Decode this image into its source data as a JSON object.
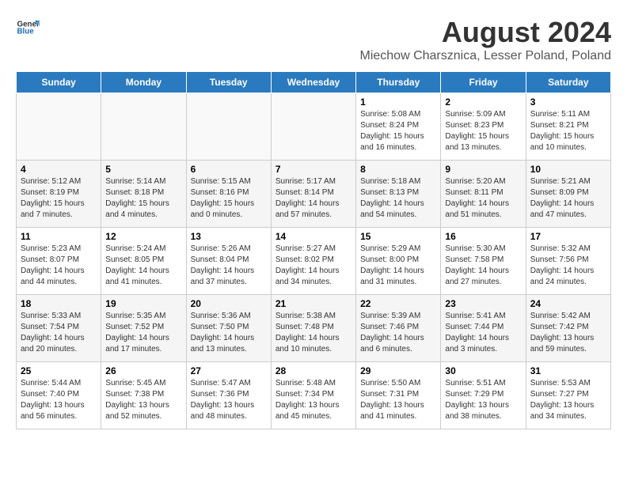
{
  "header": {
    "logo_general": "General",
    "logo_blue": "Blue",
    "title": "August 2024",
    "subtitle": "Miechow Charsznica, Lesser Poland, Poland"
  },
  "days_of_week": [
    "Sunday",
    "Monday",
    "Tuesday",
    "Wednesday",
    "Thursday",
    "Friday",
    "Saturday"
  ],
  "weeks": [
    [
      {
        "day": "",
        "info": ""
      },
      {
        "day": "",
        "info": ""
      },
      {
        "day": "",
        "info": ""
      },
      {
        "day": "",
        "info": ""
      },
      {
        "day": "1",
        "info": "Sunrise: 5:08 AM\nSunset: 8:24 PM\nDaylight: 15 hours\nand 16 minutes."
      },
      {
        "day": "2",
        "info": "Sunrise: 5:09 AM\nSunset: 8:23 PM\nDaylight: 15 hours\nand 13 minutes."
      },
      {
        "day": "3",
        "info": "Sunrise: 5:11 AM\nSunset: 8:21 PM\nDaylight: 15 hours\nand 10 minutes."
      }
    ],
    [
      {
        "day": "4",
        "info": "Sunrise: 5:12 AM\nSunset: 8:19 PM\nDaylight: 15 hours\nand 7 minutes."
      },
      {
        "day": "5",
        "info": "Sunrise: 5:14 AM\nSunset: 8:18 PM\nDaylight: 15 hours\nand 4 minutes."
      },
      {
        "day": "6",
        "info": "Sunrise: 5:15 AM\nSunset: 8:16 PM\nDaylight: 15 hours\nand 0 minutes."
      },
      {
        "day": "7",
        "info": "Sunrise: 5:17 AM\nSunset: 8:14 PM\nDaylight: 14 hours\nand 57 minutes."
      },
      {
        "day": "8",
        "info": "Sunrise: 5:18 AM\nSunset: 8:13 PM\nDaylight: 14 hours\nand 54 minutes."
      },
      {
        "day": "9",
        "info": "Sunrise: 5:20 AM\nSunset: 8:11 PM\nDaylight: 14 hours\nand 51 minutes."
      },
      {
        "day": "10",
        "info": "Sunrise: 5:21 AM\nSunset: 8:09 PM\nDaylight: 14 hours\nand 47 minutes."
      }
    ],
    [
      {
        "day": "11",
        "info": "Sunrise: 5:23 AM\nSunset: 8:07 PM\nDaylight: 14 hours\nand 44 minutes."
      },
      {
        "day": "12",
        "info": "Sunrise: 5:24 AM\nSunset: 8:05 PM\nDaylight: 14 hours\nand 41 minutes."
      },
      {
        "day": "13",
        "info": "Sunrise: 5:26 AM\nSunset: 8:04 PM\nDaylight: 14 hours\nand 37 minutes."
      },
      {
        "day": "14",
        "info": "Sunrise: 5:27 AM\nSunset: 8:02 PM\nDaylight: 14 hours\nand 34 minutes."
      },
      {
        "day": "15",
        "info": "Sunrise: 5:29 AM\nSunset: 8:00 PM\nDaylight: 14 hours\nand 31 minutes."
      },
      {
        "day": "16",
        "info": "Sunrise: 5:30 AM\nSunset: 7:58 PM\nDaylight: 14 hours\nand 27 minutes."
      },
      {
        "day": "17",
        "info": "Sunrise: 5:32 AM\nSunset: 7:56 PM\nDaylight: 14 hours\nand 24 minutes."
      }
    ],
    [
      {
        "day": "18",
        "info": "Sunrise: 5:33 AM\nSunset: 7:54 PM\nDaylight: 14 hours\nand 20 minutes."
      },
      {
        "day": "19",
        "info": "Sunrise: 5:35 AM\nSunset: 7:52 PM\nDaylight: 14 hours\nand 17 minutes."
      },
      {
        "day": "20",
        "info": "Sunrise: 5:36 AM\nSunset: 7:50 PM\nDaylight: 14 hours\nand 13 minutes."
      },
      {
        "day": "21",
        "info": "Sunrise: 5:38 AM\nSunset: 7:48 PM\nDaylight: 14 hours\nand 10 minutes."
      },
      {
        "day": "22",
        "info": "Sunrise: 5:39 AM\nSunset: 7:46 PM\nDaylight: 14 hours\nand 6 minutes."
      },
      {
        "day": "23",
        "info": "Sunrise: 5:41 AM\nSunset: 7:44 PM\nDaylight: 14 hours\nand 3 minutes."
      },
      {
        "day": "24",
        "info": "Sunrise: 5:42 AM\nSunset: 7:42 PM\nDaylight: 13 hours\nand 59 minutes."
      }
    ],
    [
      {
        "day": "25",
        "info": "Sunrise: 5:44 AM\nSunset: 7:40 PM\nDaylight: 13 hours\nand 56 minutes."
      },
      {
        "day": "26",
        "info": "Sunrise: 5:45 AM\nSunset: 7:38 PM\nDaylight: 13 hours\nand 52 minutes."
      },
      {
        "day": "27",
        "info": "Sunrise: 5:47 AM\nSunset: 7:36 PM\nDaylight: 13 hours\nand 48 minutes."
      },
      {
        "day": "28",
        "info": "Sunrise: 5:48 AM\nSunset: 7:34 PM\nDaylight: 13 hours\nand 45 minutes."
      },
      {
        "day": "29",
        "info": "Sunrise: 5:50 AM\nSunset: 7:31 PM\nDaylight: 13 hours\nand 41 minutes."
      },
      {
        "day": "30",
        "info": "Sunrise: 5:51 AM\nSunset: 7:29 PM\nDaylight: 13 hours\nand 38 minutes."
      },
      {
        "day": "31",
        "info": "Sunrise: 5:53 AM\nSunset: 7:27 PM\nDaylight: 13 hours\nand 34 minutes."
      }
    ]
  ]
}
